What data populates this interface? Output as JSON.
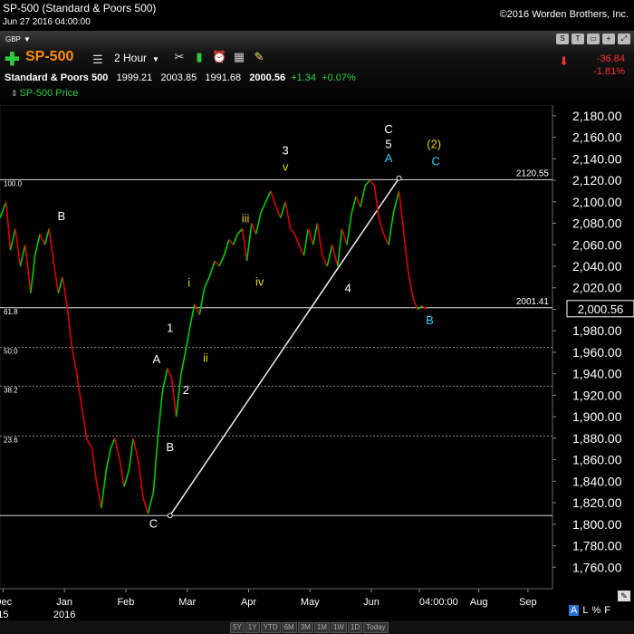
{
  "header": {
    "title": "SP-500 (Standard & Poors 500)",
    "datetime": "Jun 27 2016 04:00:00",
    "copyright": "©2016 Worden Brothers, Inc."
  },
  "toolbar": {
    "currency": "GBP",
    "symbol": "SP-500",
    "interval": "2 Hour",
    "change_abs": "-36.84",
    "change_pct": "-1.81%",
    "top_right_buttons": [
      "S",
      "T",
      "▭",
      "+",
      "⤢"
    ]
  },
  "quote": {
    "name": "Standard & Poors 500",
    "open": "1999.21",
    "high": "2003.85",
    "low": "1991.68",
    "last": "2000.56",
    "change": "+1.34",
    "change_pct": "+0.07%"
  },
  "indicator_label": "SP-500 Price",
  "range_buttons": [
    "5Y",
    "1Y",
    "YTD",
    "6M",
    "3M",
    "1M",
    "1W",
    "1D",
    "Today"
  ],
  "bottom_controls": {
    "a": "A",
    "l": "L",
    "pct": "%",
    "f": "F"
  },
  "colors": {
    "up": "#00cc00",
    "down": "#dd0000",
    "accent": "#ff8c00",
    "yellow": "#e8d400",
    "cyan": "#33ccff"
  },
  "chart_data": {
    "type": "line",
    "title": "",
    "xlabel": "",
    "ylabel": "",
    "ylim": [
      1740,
      2190
    ],
    "y_ticks": [
      "1,760.00",
      "1,780.00",
      "1,800.00",
      "1,820.00",
      "1,840.00",
      "1,860.00",
      "1,880.00",
      "1,900.00",
      "1,920.00",
      "1,940.00",
      "1,960.00",
      "1,980.00",
      "2,000.00",
      "2,020.00",
      "2,040.00",
      "2,060.00",
      "2,080.00",
      "2,100.00",
      "2,120.00",
      "2,140.00",
      "2,160.00",
      "2,180.00"
    ],
    "x_ticks": [
      {
        "label": "Dec",
        "pos": 0.0
      },
      {
        "label": "Jan",
        "pos": 1.0
      },
      {
        "label": "Feb",
        "pos": 2.0
      },
      {
        "label": "Mar",
        "pos": 3.0
      },
      {
        "label": "Apr",
        "pos": 4.0
      },
      {
        "label": "May",
        "pos": 5.0
      },
      {
        "label": "Jun",
        "pos": 6.0
      },
      {
        "label": "04:00:00",
        "pos": 6.78
      },
      {
        "label": "Aug",
        "pos": 7.75
      },
      {
        "label": "Sep",
        "pos": 8.55
      }
    ],
    "x_sub_labels": [
      {
        "label": "15",
        "pos": 0.0
      },
      {
        "label": "2016",
        "pos": 1.0
      }
    ],
    "x_range": [
      -0.05,
      8.95
    ],
    "last_value": "2,000.56",
    "series": [
      {
        "x": [
          -0.05,
          0.05,
          0.12,
          0.2,
          0.28,
          0.36,
          0.45,
          0.52,
          0.6,
          0.68,
          0.75,
          0.82,
          0.9,
          0.97,
          1.05,
          1.12,
          1.2,
          1.28,
          1.36,
          1.45,
          1.52,
          1.6,
          1.68,
          1.75,
          1.82,
          1.9,
          1.97,
          2.05,
          2.12,
          2.2,
          2.28,
          2.36,
          2.45,
          2.52,
          2.6,
          2.68,
          2.75,
          2.82,
          2.9,
          2.97,
          3.05,
          3.12,
          3.2,
          3.28,
          3.36,
          3.45,
          3.52,
          3.6,
          3.68,
          3.75,
          3.82,
          3.9,
          3.97,
          4.05,
          4.12,
          4.2,
          4.28,
          4.36,
          4.45,
          4.52,
          4.6,
          4.68,
          4.75,
          4.82,
          4.9,
          4.97,
          5.05,
          5.12,
          5.2,
          5.28,
          5.36,
          5.45,
          5.52,
          5.6,
          5.68,
          5.75,
          5.82,
          5.9,
          5.97,
          6.05,
          6.12,
          6.2,
          6.28,
          6.36,
          6.45,
          6.52,
          6.6,
          6.68,
          6.75,
          6.82,
          6.9
        ],
        "y": [
          2085,
          2100,
          2055,
          2075,
          2040,
          2060,
          2015,
          2050,
          2070,
          2060,
          2075,
          2045,
          2015,
          2030,
          2000,
          1965,
          1940,
          1910,
          1880,
          1870,
          1840,
          1815,
          1850,
          1870,
          1880,
          1860,
          1835,
          1850,
          1880,
          1860,
          1825,
          1810,
          1830,
          1880,
          1925,
          1945,
          1935,
          1900,
          1940,
          1960,
          1985,
          2005,
          1995,
          2020,
          2030,
          2045,
          2040,
          2050,
          2065,
          2060,
          2070,
          2075,
          2045,
          2080,
          2070,
          2090,
          2100,
          2110,
          2095,
          2085,
          2100,
          2075,
          2070,
          2060,
          2050,
          2075,
          2060,
          2080,
          2050,
          2040,
          2060,
          2040,
          2075,
          2060,
          2090,
          2105,
          2095,
          2115,
          2120,
          2115,
          2085,
          2070,
          2060,
          2090,
          2110,
          2075,
          2035,
          2010,
          2000,
          2003,
          2000.56
        ]
      }
    ],
    "hlines": [
      {
        "y": 2120.55,
        "label": "2120.55",
        "style": "solid"
      },
      {
        "y": 2001.41,
        "label": "2001.41",
        "style": "solid"
      },
      {
        "y": 1808,
        "label": "",
        "style": "solid"
      },
      {
        "y": 1964.5,
        "label": "50.0",
        "style": "dashed"
      },
      {
        "y": 1928.5,
        "label": "38.2",
        "style": "dashed"
      },
      {
        "y": 1882,
        "label": "23.6",
        "style": "dashed"
      }
    ],
    "fib_labels": [
      {
        "label": "100.0",
        "y": 2120.55
      },
      {
        "label": "61.8",
        "y": 2001.41
      },
      {
        "label": "50.0",
        "y": 1964.5
      },
      {
        "label": "38.2",
        "y": 1928.5
      },
      {
        "label": "23.6",
        "y": 1882
      }
    ],
    "trendline": {
      "x1": 2.72,
      "y1": 1808,
      "x2": 6.45,
      "y2": 2122
    },
    "annotations": [
      {
        "text": "B",
        "x": 0.95,
        "y": 2083,
        "color": "white"
      },
      {
        "text": "C",
        "x": 2.45,
        "y": 1797,
        "color": "white"
      },
      {
        "text": "A",
        "x": 2.5,
        "y": 1950,
        "color": "white"
      },
      {
        "text": "B",
        "x": 2.72,
        "y": 1868,
        "color": "white"
      },
      {
        "text": "1",
        "x": 2.72,
        "y": 1979,
        "color": "white"
      },
      {
        "text": "2",
        "x": 2.98,
        "y": 1921,
        "color": "white"
      },
      {
        "text": "i",
        "x": 3.03,
        "y": 2021,
        "color": "yellow"
      },
      {
        "text": "ii",
        "x": 3.3,
        "y": 1951,
        "color": "yellow"
      },
      {
        "text": "iii",
        "x": 3.95,
        "y": 2081,
        "color": "yellow"
      },
      {
        "text": "iv",
        "x": 4.18,
        "y": 2022,
        "color": "yellow"
      },
      {
        "text": "3",
        "x": 4.6,
        "y": 2144,
        "color": "white"
      },
      {
        "text": "v",
        "x": 4.6,
        "y": 2129,
        "color": "yellow"
      },
      {
        "text": "4",
        "x": 5.62,
        "y": 2016,
        "color": "white"
      },
      {
        "text": "C",
        "x": 6.28,
        "y": 2164,
        "color": "white"
      },
      {
        "text": "5",
        "x": 6.28,
        "y": 2150,
        "color": "white"
      },
      {
        "text": "A",
        "x": 6.28,
        "y": 2137,
        "color": "cyan"
      },
      {
        "text": "(2)",
        "x": 7.02,
        "y": 2150,
        "color": "yellow"
      },
      {
        "text": "C",
        "x": 7.05,
        "y": 2134,
        "color": "cyan"
      },
      {
        "text": "B",
        "x": 6.95,
        "y": 1986,
        "color": "cyan"
      }
    ]
  }
}
